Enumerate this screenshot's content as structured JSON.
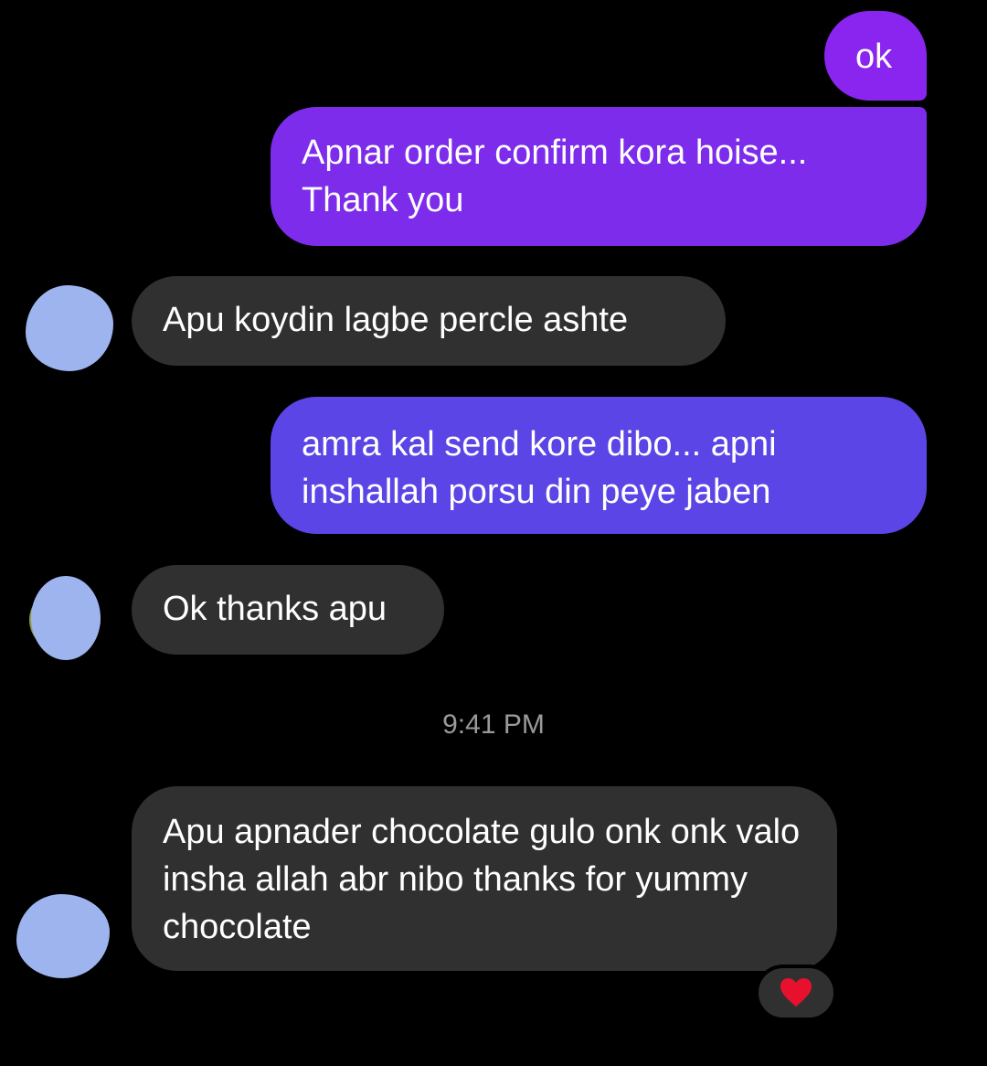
{
  "messages": [
    {
      "id": "ok",
      "direction": "outgoing",
      "text": "ok"
    },
    {
      "id": "confirm",
      "direction": "outgoing",
      "text": "Apnar order confirm kora hoise... Thank you"
    },
    {
      "id": "koydin",
      "direction": "incoming",
      "text": "Apu koydin lagbe percle ashte"
    },
    {
      "id": "send",
      "direction": "outgoing",
      "text": "amra kal send kore dibo... apni inshallah porsu din peye jaben"
    },
    {
      "id": "thanks",
      "direction": "incoming",
      "text": "Ok thanks apu"
    },
    {
      "id": "chocolate",
      "direction": "incoming",
      "text": "Apu apnader chocolate gulo onk onk valo insha allah abr nibo thanks for yummy chocolate"
    }
  ],
  "timestamp": "9:41 PM",
  "reaction": {
    "icon": "heart-icon",
    "color": "#e8112d"
  },
  "colors": {
    "background": "#000000",
    "outgoing_top": "#8a25ef",
    "outgoing_bottom": "#5b45e6",
    "incoming": "#303030",
    "avatar_redaction": "#9db4ee"
  }
}
